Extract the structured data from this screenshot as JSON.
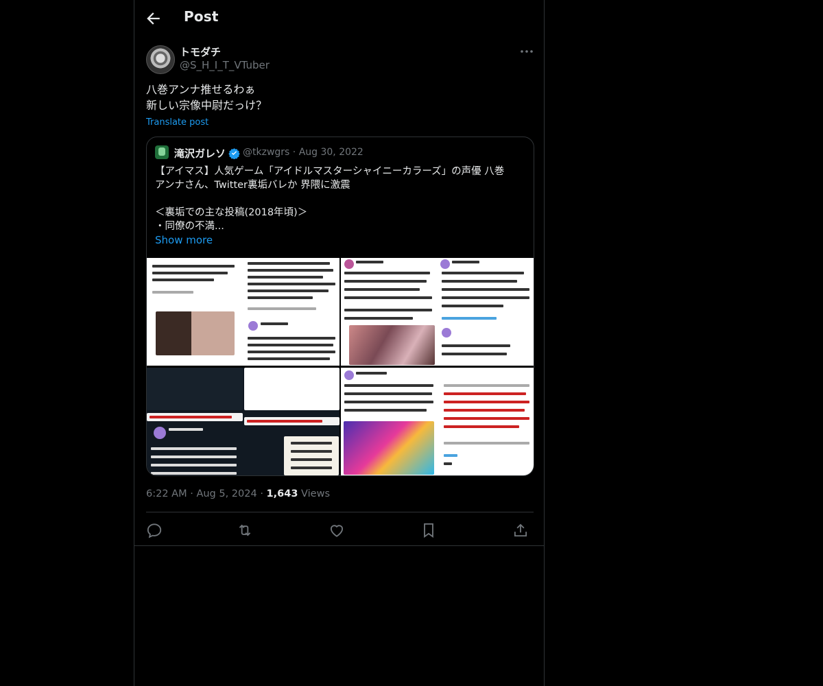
{
  "header": {
    "title": "Post"
  },
  "post": {
    "author_name": "トモダチ",
    "author_handle": "@S_H_I_T_VTuber",
    "text_lines": [
      "八巻アンナ推せるわぁ",
      "新しい宗像中尉だっけ？"
    ],
    "translate_label": "Translate post",
    "time": "6:22 AM",
    "date": "Aug 5, 2024",
    "views_count": "1,643",
    "views_label": "Views"
  },
  "quote": {
    "author_name": "滝沢ガレソ",
    "author_handle": "@tkzwgrs",
    "date": "Aug 30, 2022",
    "text_lines": [
      "【アイマス】人気ゲーム「アイドルマスターシャイニーカラーズ」の声優 八巻",
      "アンナさん、Twitter裏垢バレか 界隈に激震",
      "",
      "＜裏垢での主な投稿(2018年頃)＞",
      "・同僚の不満..."
    ],
    "show_more_label": "Show more"
  },
  "colors": {
    "accent": "#1d9bf0",
    "muted": "#71767b",
    "text": "#e7e9ea",
    "border": "#2f3336"
  }
}
